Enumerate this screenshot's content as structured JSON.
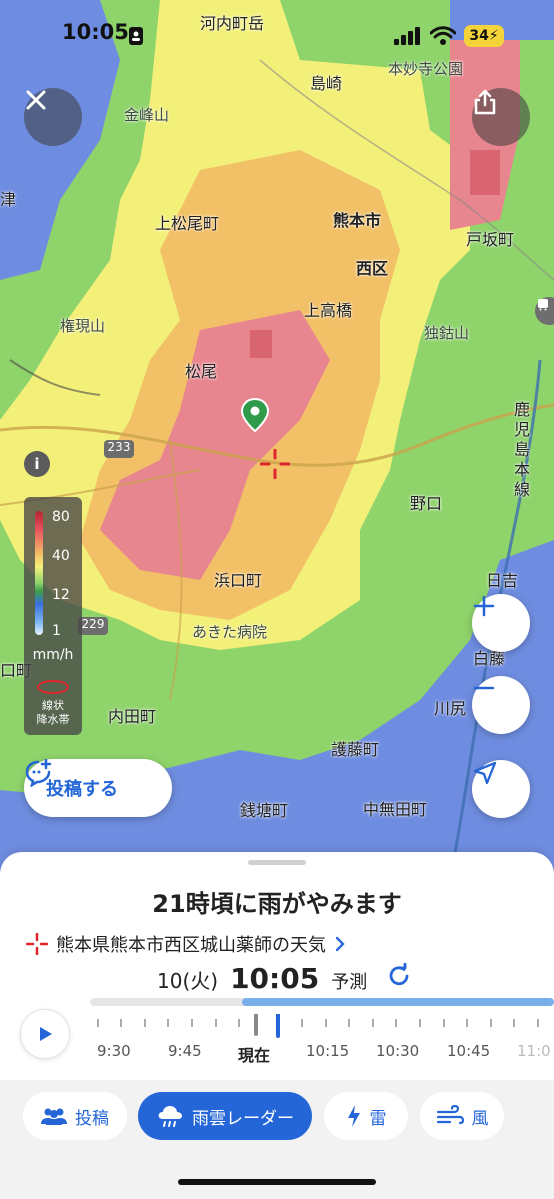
{
  "status_bar": {
    "time": "10:05",
    "battery": "34"
  },
  "map": {
    "places": [
      "河内町岳",
      "島崎",
      "本妙寺公園",
      "金峰山",
      "津",
      "上松尾町",
      "熊本市",
      "戸坂町",
      "西区",
      "上高橋",
      "権現山",
      "独鈷山",
      "松尾",
      "鹿児島本線",
      "233",
      "野口",
      "浜口町",
      "日吉",
      "229",
      "あきた病院",
      "白藤",
      "口町",
      "内田町",
      "川尻",
      "護藤町",
      "銭塘町",
      "中無田町"
    ],
    "legend": {
      "values": [
        "80",
        "40",
        "12",
        "1"
      ],
      "unit": "mm/h",
      "band_label": "線状\n降水帯"
    }
  },
  "post_button": {
    "label": "投稿する"
  },
  "sheet": {
    "headline": "21時頃に雨がやみます",
    "location": "熊本県熊本市西区城山薬師の天気",
    "date": "10(火)",
    "time": "10:05",
    "mode": "予測",
    "timeline_labels": [
      "9:30",
      "9:45",
      "現在",
      "10:15",
      "10:30",
      "10:45",
      "11:0"
    ]
  },
  "tabs": [
    {
      "label": "投稿",
      "icon": "people-icon"
    },
    {
      "label": "雨雲レーダー",
      "icon": "rain-cloud-icon"
    },
    {
      "label": "雷",
      "icon": "lightning-icon"
    },
    {
      "label": "風",
      "icon": "wind-icon"
    }
  ],
  "colors": {
    "accent": "#2466d8",
    "rain_heavy": "#e8868f",
    "rain_mid": "#f2c066",
    "rain_light": "#f3f07a",
    "rain_green": "#8fd36b",
    "rain_blue": "#6f8de0"
  }
}
